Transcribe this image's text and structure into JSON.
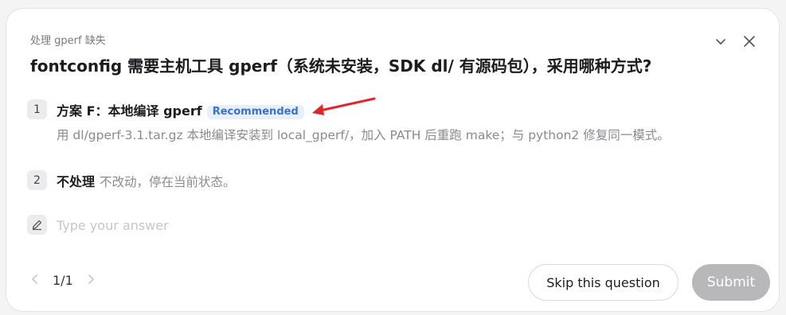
{
  "header": {
    "eyebrow": "处理 gperf 缺失",
    "title": "fontconfig 需要主机工具 gperf（系统未安装，SDK dl/ 有源码包），采用哪种方式?"
  },
  "options": [
    {
      "number": "1",
      "title": "方案 F：本地编译 gperf",
      "badge": "Recommended",
      "description": "用 dl/gperf-3.1.tar.gz 本地编译安装到 local_gperf/，加入 PATH 后重跑 make；与 python2 修复同一模式。"
    },
    {
      "number": "2",
      "title": "不处理",
      "description": "不改动，停在当前状态。"
    }
  ],
  "answer": {
    "placeholder": "Type your answer",
    "value": ""
  },
  "pager": {
    "label": "1/1"
  },
  "buttons": {
    "skip": "Skip this question",
    "submit": "Submit"
  },
  "colors": {
    "badge_bg": "#e7effb",
    "badge_text": "#3b72c8",
    "submit_bg": "#b8b8bb",
    "annotation_arrow": "#e0262d"
  },
  "icons": {
    "collapse": "chevron-down-icon",
    "close": "close-icon",
    "answer": "pencil-icon",
    "prev": "chevron-left-icon",
    "next": "chevron-right-icon"
  }
}
